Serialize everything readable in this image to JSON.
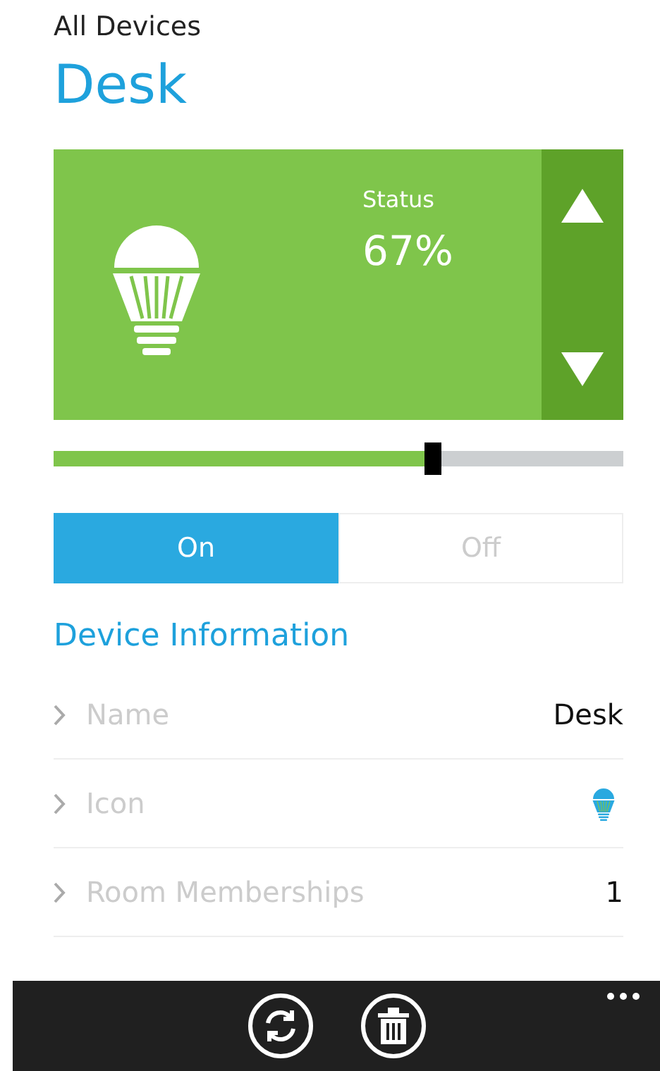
{
  "breadcrumb": "All Devices",
  "title": "Desk",
  "status": {
    "label": "Status",
    "value": "67%"
  },
  "brightness": {
    "level": 0.665
  },
  "power": [
    {
      "label": "On",
      "selected": true
    },
    {
      "label": "Off",
      "selected": false
    }
  ],
  "section_title": "Device Information",
  "info_rows": [
    {
      "kind": "text",
      "label": "Name",
      "value": "Desk"
    },
    {
      "kind": "icon",
      "label": "Icon"
    },
    {
      "kind": "text",
      "label": "Room Memberships",
      "value": "1"
    }
  ]
}
